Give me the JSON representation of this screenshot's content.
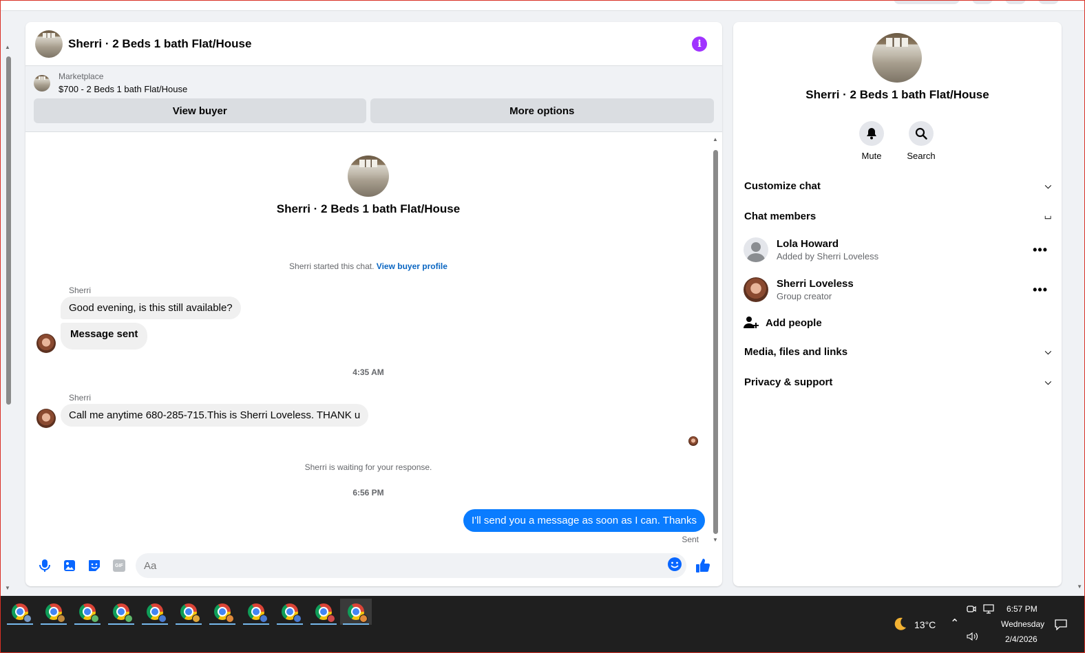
{
  "conversation": {
    "title": "Sherri · 2 Beds 1 bath Flat/House"
  },
  "marketplace": {
    "label": "Marketplace",
    "listing": "$700 - 2 Beds 1 bath Flat/House",
    "view_buyer": "View buyer",
    "more_options": "More options"
  },
  "thread": {
    "intro_title": "Sherri · 2 Beds 1 bath Flat/House",
    "started_text": "Sherri started this chat.",
    "view_buyer_profile": "View buyer profile",
    "messages": [
      {
        "sender": "Sherri",
        "text": "Good evening, is this still available?"
      },
      {
        "text": "Message sent"
      },
      {
        "sender": "Sherri",
        "text": "Call me anytime 680-285-715.This is Sherri Loveless. THANK u"
      },
      {
        "text": "I'll send you a message as soon as I can. Thanks",
        "status": "Sent"
      }
    ],
    "time1": "4:35 AM",
    "time2": "6:56 PM",
    "waiting": "Sherri is waiting for your response."
  },
  "composer": {
    "placeholder": "Aa"
  },
  "info_panel": {
    "title": "Sherri · 2 Beds 1 bath Flat/House",
    "mute": "Mute",
    "search": "Search",
    "customize_chat": "Customize chat",
    "chat_members": "Chat members",
    "members": [
      {
        "name": "Lola Howard",
        "subtitle": "Added by Sherri Loveless"
      },
      {
        "name": "Sherri Loveless",
        "subtitle": "Group creator"
      }
    ],
    "add_people": "Add people",
    "media": "Media, files and links",
    "privacy": "Privacy & support"
  },
  "taskbar": {
    "temperature": "13°C",
    "time": "6:57 PM",
    "day": "Wednesday",
    "date": "2/4/2026",
    "app_icons": [
      "chrome-icon",
      "chrome-icon",
      "chrome-icon",
      "chrome-icon",
      "chrome-icon",
      "chrome-icon",
      "chrome-icon",
      "chrome-icon",
      "chrome-icon",
      "chrome-icon",
      "chrome-icon"
    ]
  },
  "colors": {
    "accent": "#0a7cff",
    "info": "#a033ff",
    "like": "#0866ff"
  }
}
